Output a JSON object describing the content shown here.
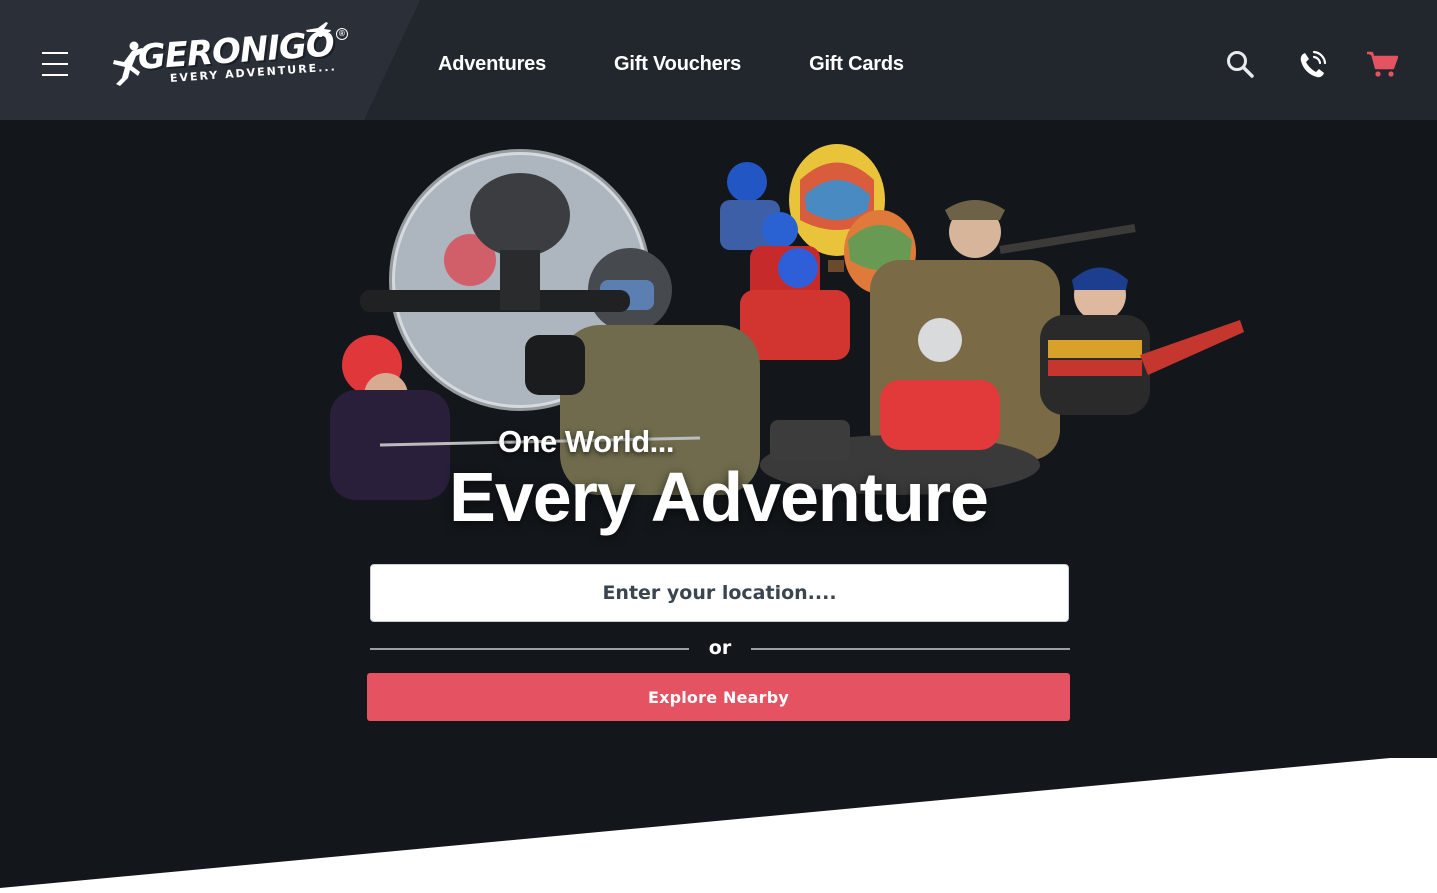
{
  "header": {
    "menu_icon": "hamburger-menu-icon",
    "logo": {
      "brand": "GERONIGO",
      "tagline": "EVERY ADVENTURE...",
      "reg_mark": "®"
    },
    "nav": [
      {
        "label": "Adventures"
      },
      {
        "label": "Gift Vouchers"
      },
      {
        "label": "Gift Cards"
      }
    ],
    "icons": [
      "search-icon",
      "phone-icon",
      "cart-icon"
    ]
  },
  "hero": {
    "tagline": "One World...",
    "headline": "Every Adventure",
    "location_placeholder": "Enter your location....",
    "or_label": "or",
    "explore_label": "Explore Nearby"
  },
  "colors": {
    "header_bg": "#22272e",
    "page_bg": "#13171b",
    "accent": "#e55363",
    "cart_icon": "#e55363"
  }
}
